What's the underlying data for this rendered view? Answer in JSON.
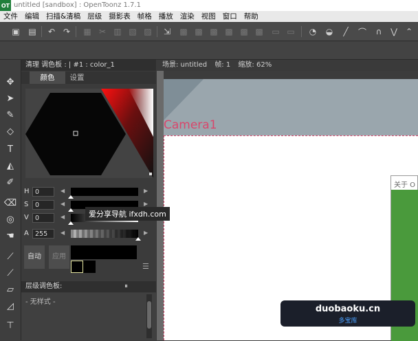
{
  "window": {
    "title": "untitled [sandbox] : OpenToonz 1.7.1",
    "logo_text": "OT"
  },
  "menu": {
    "items": [
      "文件",
      "编辑",
      "扫描&清稿",
      "层级",
      "摄影表",
      "帧格",
      "播放",
      "渲染",
      "视图",
      "窗口",
      "帮助"
    ]
  },
  "style_editor": {
    "header": "清理 调色板 : | #1 : color_1",
    "tabs": [
      "颜色",
      "设置"
    ],
    "channels": [
      {
        "label": "H",
        "value": "0",
        "thumb_fraction": 0.0
      },
      {
        "label": "S",
        "value": "0",
        "thumb_fraction": 0.0
      },
      {
        "label": "V",
        "value": "0",
        "thumb_fraction": 0.0
      },
      {
        "label": "A",
        "value": "255",
        "thumb_fraction": 1.0
      }
    ],
    "auto_label": "自动",
    "apply_label": "应用"
  },
  "level_palette": {
    "header": "层级调色板:",
    "pin_glyph": "⏸",
    "no_style": "- 无样式 -"
  },
  "viewer": {
    "header_scene_label": "场景: untitled",
    "header_frame_label": "帧: 1",
    "header_zoom_label": "缩放: 62%",
    "camera_label": "Camera1"
  },
  "about_dialog": {
    "title": "关于 O"
  },
  "overlays": {
    "watermark_text": "爱分享导航 ifxdh.com",
    "badge_main": "duobaoku.cn",
    "badge_sub": "多宝库"
  },
  "colors": {
    "accent_camera": "#d9466b",
    "current_style": "#000000"
  }
}
